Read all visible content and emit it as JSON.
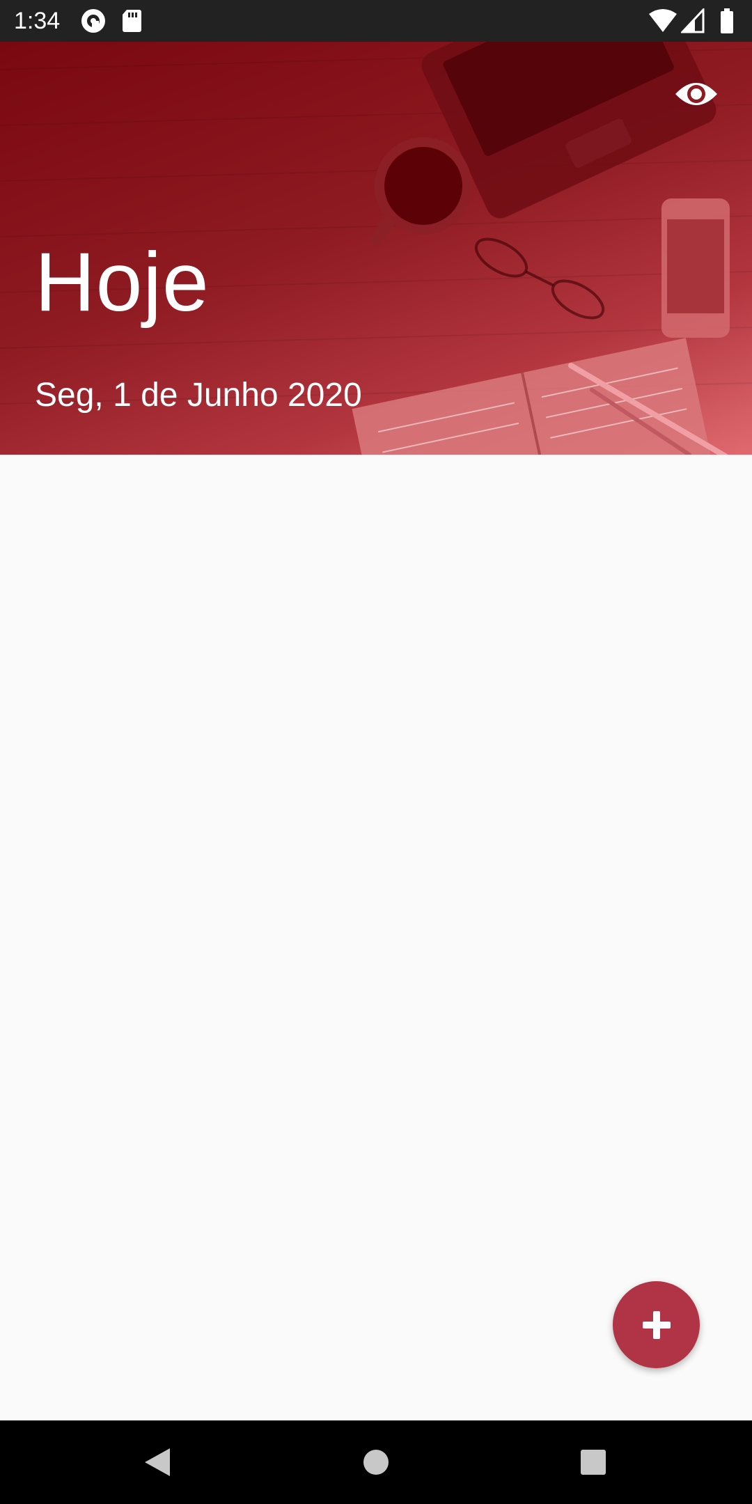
{
  "status_bar": {
    "time": "1:34",
    "icons": [
      "pocket-casts-icon",
      "sd-card-icon",
      "wifi-icon",
      "signal-icon",
      "battery-icon"
    ]
  },
  "header": {
    "title": "Hoje",
    "date": "Seg, 1 de Junho 2020",
    "action_icon": "eye-icon",
    "colors": {
      "overlay_dark": "#7a0810",
      "overlay_light": "#e06a70"
    }
  },
  "fab": {
    "icon": "plus-icon",
    "color": "#b03446"
  },
  "nav_bar": {
    "buttons": [
      "back-icon",
      "home-icon",
      "recents-icon"
    ]
  }
}
